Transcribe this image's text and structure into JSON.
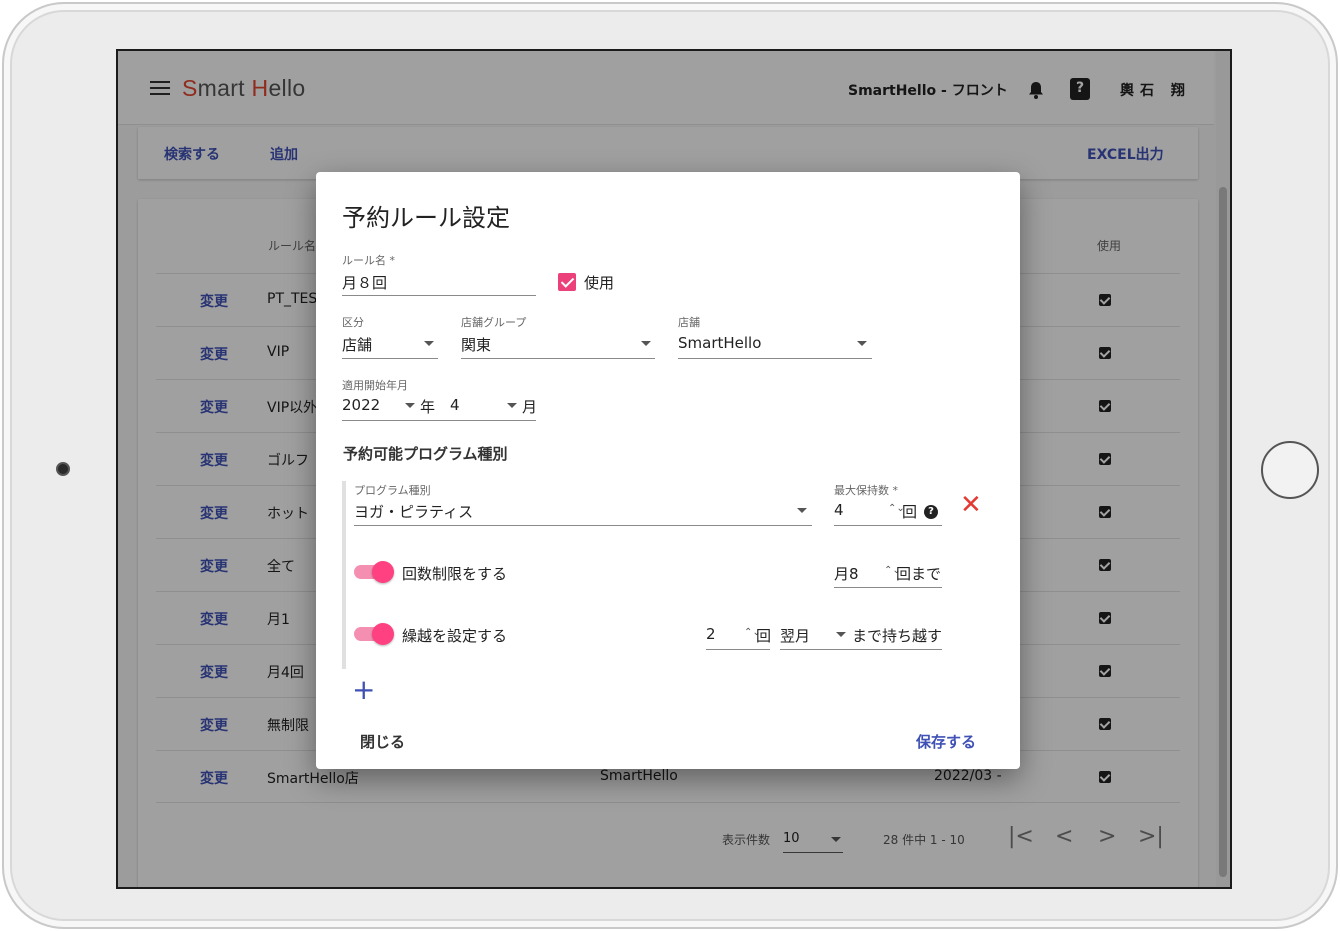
{
  "appbar": {
    "logo_first": "S",
    "logo_mid": "mart ",
    "logo_h": "H",
    "logo_rest": "ello",
    "app_name": "SmartHello - フロント",
    "help_icon_glyph": "?",
    "user_name": "輿石 翔"
  },
  "actions": {
    "search": "検索する",
    "add": "追加",
    "excel": "EXCEL出力"
  },
  "table": {
    "headers": {
      "rule_name": "ルール名",
      "use": "使用"
    },
    "rows": [
      {
        "edit": "変更",
        "name": "PT_TES",
        "group": "",
        "date": ""
      },
      {
        "edit": "変更",
        "name": "VIP",
        "group": "",
        "date": ""
      },
      {
        "edit": "変更",
        "name": "VIP以外",
        "group": "",
        "date": ""
      },
      {
        "edit": "変更",
        "name": "ゴルフ",
        "group": "",
        "date": ""
      },
      {
        "edit": "変更",
        "name": "ホット",
        "group": "",
        "date": ""
      },
      {
        "edit": "変更",
        "name": "全て",
        "group": "",
        "date": ""
      },
      {
        "edit": "変更",
        "name": "月1",
        "group": "",
        "date": ""
      },
      {
        "edit": "変更",
        "name": "月4回",
        "group": "",
        "date": ""
      },
      {
        "edit": "変更",
        "name": "無制限",
        "group": "",
        "date": ""
      },
      {
        "edit": "変更",
        "name": "SmartHello店",
        "group": "SmartHello",
        "date": "2022/03 -"
      }
    ],
    "pager": {
      "rows_label": "表示件数",
      "rows_value": "10",
      "range": "28 件中 1 - 10",
      "first": "|<",
      "prev": "<",
      "next": ">",
      "last": ">|"
    }
  },
  "dialog": {
    "title": "予約ルール設定",
    "rule_name_label": "ルール名 *",
    "rule_name_value": "月８回",
    "use_label": "使用",
    "category_label": "区分",
    "category_value": "店舗",
    "store_group_label": "店舗グループ",
    "store_group_value": "関東",
    "store_label": "店舗",
    "store_value": "SmartHello",
    "start_label": "適用開始年月",
    "start_year": "2022",
    "year_unit": "年",
    "start_month": "4",
    "month_unit": "月",
    "program_section_title": "予約可能プログラム種別",
    "program": {
      "type_label": "プログラム種別",
      "type_value": "ヨガ・ピラティス",
      "max_label": "最大保持数 *",
      "max_value": "4",
      "max_unit": "回",
      "help_glyph": "?",
      "remove_glyph": "✕",
      "limit_toggle_label": "回数制限をする",
      "limit_value": "月8",
      "limit_unit": "回まで",
      "carry_toggle_label": "繰越を設定する",
      "carry_count": "2",
      "carry_unit": "回",
      "carry_period": "翌月",
      "carry_suffix": "まで持ち越す",
      "spin_glyph": "⌃⌄"
    },
    "add_glyph": "+",
    "close_button": "閉じる",
    "save_button": "保存する"
  },
  "colors": {
    "accent": "#3f51b5",
    "pink": "#ec407a",
    "logo_red": "#e0452f",
    "danger": "#e53935"
  }
}
